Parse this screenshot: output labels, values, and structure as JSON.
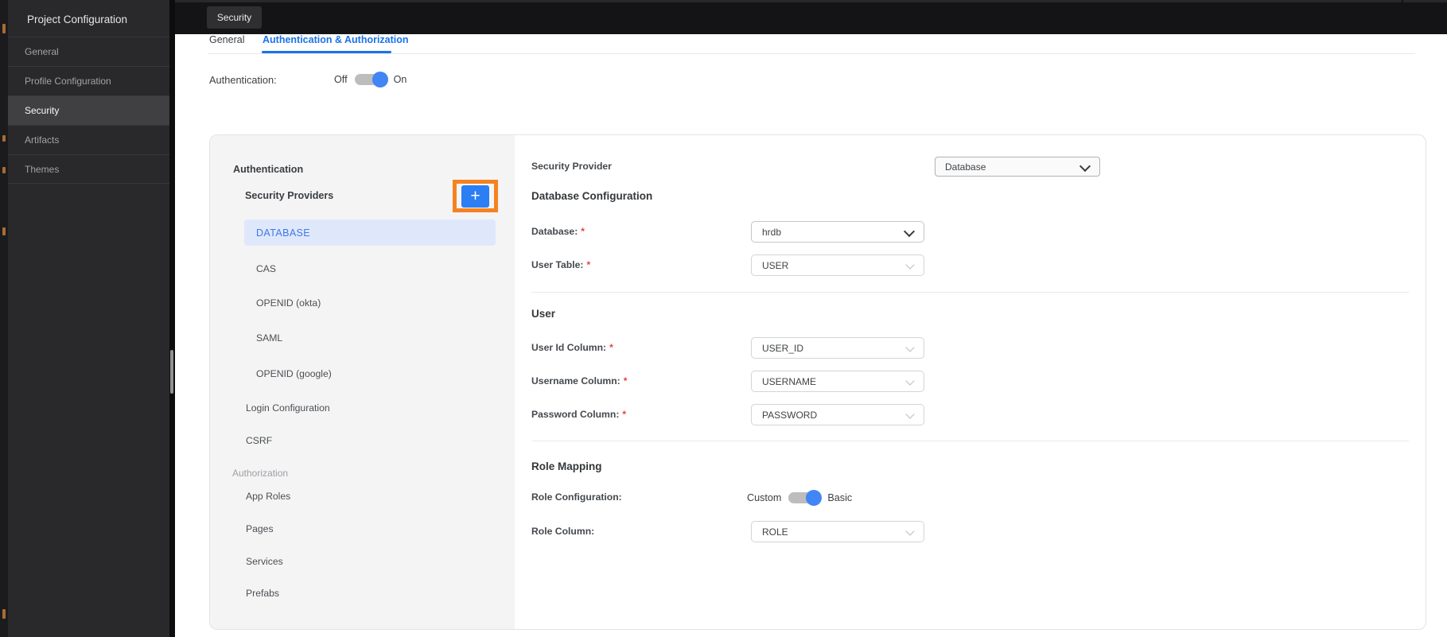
{
  "chrome": {
    "tab_label": "Security"
  },
  "sidebar": {
    "title": "Project Configuration",
    "items": [
      {
        "label": "General"
      },
      {
        "label": "Profile Configuration"
      },
      {
        "label": "Security",
        "active": true
      },
      {
        "label": "Artifacts"
      },
      {
        "label": "Themes"
      }
    ]
  },
  "tabs": {
    "items": [
      {
        "label": "General"
      },
      {
        "label": "Authentication & Authorization",
        "active": true
      }
    ]
  },
  "auth_row": {
    "label": "Authentication:",
    "off": "Off",
    "on": "On",
    "state": "on"
  },
  "nav": {
    "section_auth": "Authentication",
    "providers_header": "Security Providers",
    "add_button": "+",
    "providers": [
      {
        "label": "DATABASE",
        "active": true
      },
      {
        "label": "CAS"
      },
      {
        "label": "OPENID (okta)"
      },
      {
        "label": "SAML"
      },
      {
        "label": "OPENID (google)"
      }
    ],
    "items": [
      {
        "label": "Login Configuration"
      },
      {
        "label": "CSRF"
      }
    ],
    "section_authz": "Authorization",
    "authz_items": [
      {
        "label": "App Roles"
      },
      {
        "label": "Pages"
      },
      {
        "label": "Services"
      },
      {
        "label": "Prefabs"
      }
    ]
  },
  "form": {
    "security_provider": {
      "label": "Security Provider",
      "value": "Database"
    },
    "database_section": {
      "heading": "Database Configuration",
      "database": {
        "label": "Database:",
        "required": "*",
        "value": "hrdb"
      },
      "user_table": {
        "label": "User Table:",
        "required": "*",
        "value": "USER"
      }
    },
    "user_section": {
      "heading": "User",
      "user_id": {
        "label": "User Id Column:",
        "required": "*",
        "value": "USER_ID"
      },
      "username": {
        "label": "Username Column:",
        "required": "*",
        "value": "USERNAME"
      },
      "password": {
        "label": "Password Column:",
        "required": "*",
        "value": "PASSWORD"
      }
    },
    "role_section": {
      "heading": "Role Mapping",
      "role_configuration": {
        "label": "Role Configuration:",
        "left": "Custom",
        "right": "Basic",
        "state": "right"
      },
      "role_column": {
        "label": "Role Column:",
        "value": "ROLE"
      }
    }
  },
  "colors": {
    "accent_blue": "#1a73e8",
    "toggle_blue": "#4285f4",
    "selected_nav_bg": "#dfe8fb",
    "selected_nav_text": "#4078e8",
    "highlight_orange": "#f58220",
    "add_button_blue": "#2b7ef3"
  }
}
